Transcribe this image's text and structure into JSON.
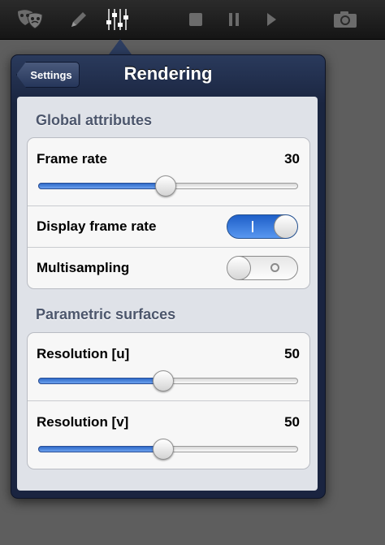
{
  "toolbar": {
    "icons": [
      "theater-masks-icon",
      "pencil-icon",
      "sliders-icon",
      "stop-icon",
      "pause-icon",
      "play-icon",
      "camera-icon"
    ],
    "active_icon": "sliders-icon"
  },
  "popover": {
    "back_label": "Settings",
    "title": "Rendering"
  },
  "sections": {
    "global": {
      "header": "Global attributes",
      "frame_rate": {
        "label": "Frame rate",
        "value": "30",
        "fraction": 0.49
      },
      "display_frame_rate": {
        "label": "Display frame rate",
        "on": true
      },
      "multisampling": {
        "label": "Multisampling",
        "on": false
      }
    },
    "parametric": {
      "header": "Parametric surfaces",
      "resolution_u": {
        "label": "Resolution [u]",
        "value": "50",
        "fraction": 0.48
      },
      "resolution_v": {
        "label": "Resolution [v]",
        "value": "50",
        "fraction": 0.48
      }
    }
  },
  "colors": {
    "accent": "#3a78dd",
    "nav_bar": "#1d2846",
    "group_bg": "#dfe2e8"
  }
}
